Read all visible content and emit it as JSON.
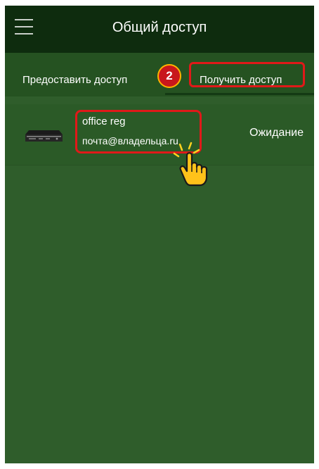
{
  "app": {
    "title": "Общий доступ"
  },
  "tabs": [
    {
      "label": "Предоставить доступ"
    },
    {
      "label": "Получить доступ"
    }
  ],
  "step_badge": "2",
  "shares": [
    {
      "name": "office reg",
      "email": "почта@владельца.ru",
      "status": "Ожидание",
      "icon": "dvr-icon"
    }
  ],
  "colors": {
    "appbar": "#0e2c0e",
    "background": "#2f5d2b",
    "highlight": "#e01919",
    "badge": "#c8171c",
    "cursor": "#ffc21a"
  }
}
